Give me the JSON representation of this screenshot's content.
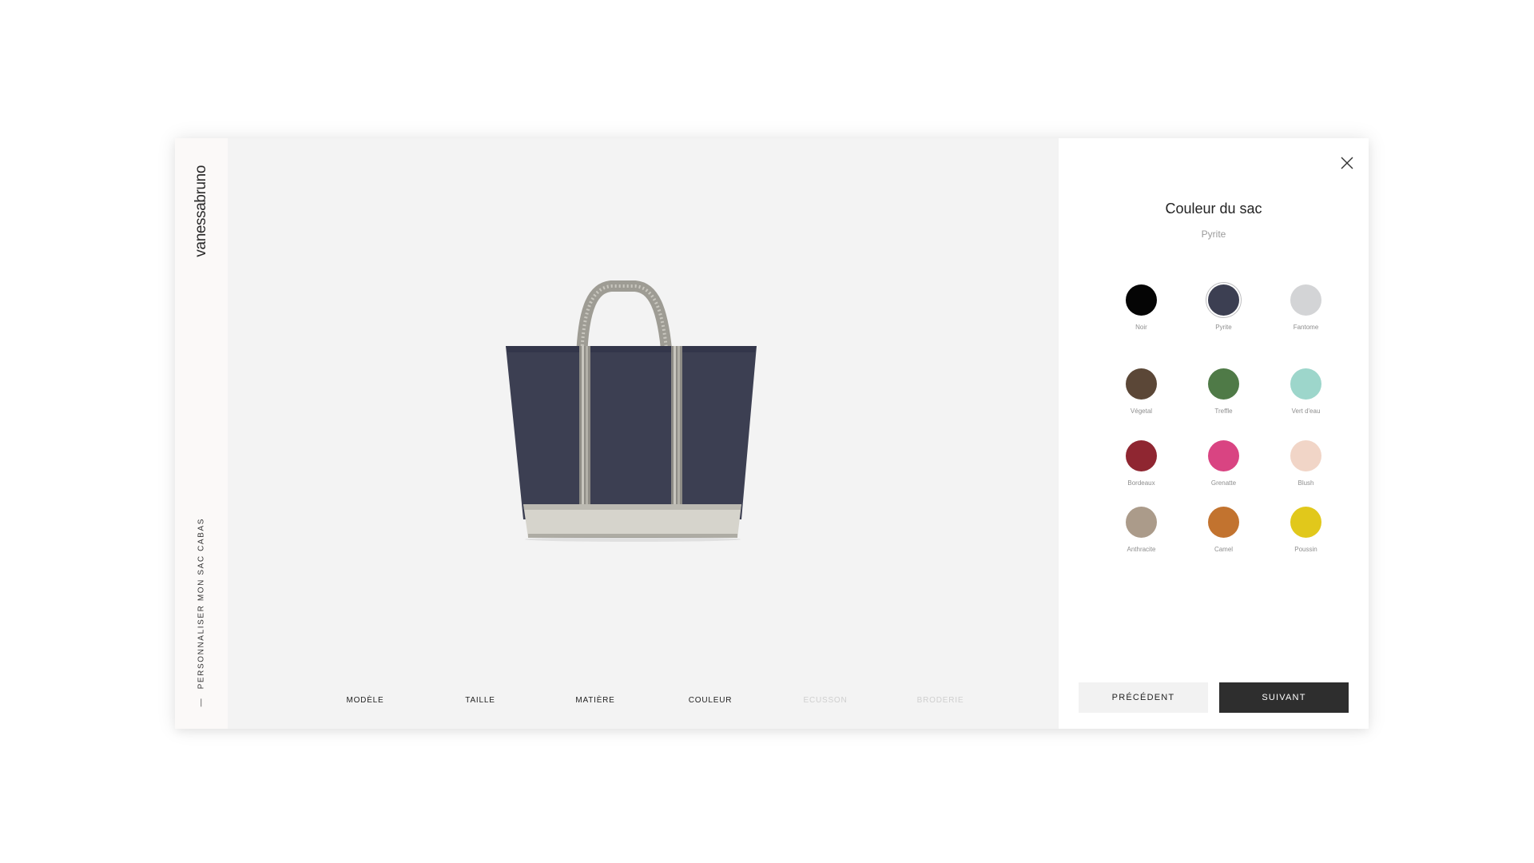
{
  "brand": "vanessabruno",
  "side_title": "PERSONNALISER MON SAC CABAS",
  "side_dash": "—",
  "steps": [
    {
      "label": "MODÈLE",
      "enabled": true
    },
    {
      "label": "TAILLE",
      "enabled": true
    },
    {
      "label": "MATIÈRE",
      "enabled": true
    },
    {
      "label": "COULEUR",
      "enabled": true
    },
    {
      "label": "ECUSSON",
      "enabled": false
    },
    {
      "label": "BRODERIE",
      "enabled": false
    }
  ],
  "panel": {
    "title": "Couleur du sac",
    "selected_color": "Pyrite",
    "colors": [
      {
        "name": "Noir",
        "hex": "#050505"
      },
      {
        "name": "Pyrite",
        "hex": "#3c3f52"
      },
      {
        "name": "Fantome",
        "hex": "#d3d4d6"
      },
      {
        "name": "Végetal",
        "hex": "#5b4737"
      },
      {
        "name": "Treffle",
        "hex": "#4f7a47"
      },
      {
        "name": "Vert d'eau",
        "hex": "#9dd6cb"
      },
      {
        "name": "Bordeaux",
        "hex": "#8f2631"
      },
      {
        "name": "Grenatte",
        "hex": "#d94482"
      },
      {
        "name": "Blush",
        "hex": "#f1d5c7"
      },
      {
        "name": "Anthracite",
        "hex": "#ab9b8a"
      },
      {
        "name": "Camel",
        "hex": "#c2732f"
      },
      {
        "name": "Poussin",
        "hex": "#e1c81b"
      }
    ],
    "prev_label": "PRÉCÉDENT",
    "next_label": "SUIVANT"
  },
  "icons": {
    "close": "close-icon"
  },
  "bag_colors": {
    "body": "#3c3f52",
    "straps": "#a8a69f",
    "base": "#d8d6cf"
  }
}
